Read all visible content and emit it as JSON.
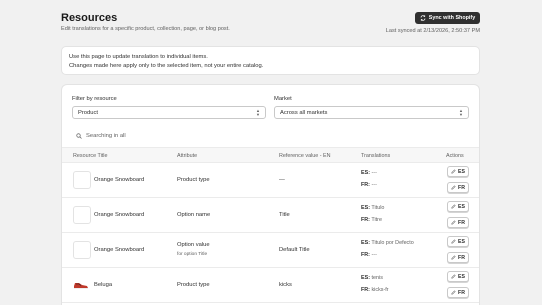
{
  "header": {
    "title": "Resources",
    "subtitle": "Edit translations for a specific product, collection, page, or blog post.",
    "sync_button": "Sync with Shopify",
    "last_synced": "Last synced at 2/13/2026, 2:50:37 PM"
  },
  "info": {
    "line1": "Use this page to update translation to individual items.",
    "line2": "Changes made here apply only to the selected item, not your entire catalog."
  },
  "filters": {
    "resource_label": "Filter by resource",
    "resource_value": "Product",
    "market_label": "Market",
    "market_value": "Across all markets"
  },
  "search": {
    "placeholder": "Searching in all"
  },
  "table": {
    "headers": {
      "title": "Resource Title",
      "attribute": "Attribute",
      "reference": "Reference value - EN",
      "translations": "Translations",
      "actions": "Actions"
    },
    "rows": [
      {
        "title": "Orange Snowboard",
        "attribute": "Product type",
        "attribute_sub": "",
        "reference": "—",
        "es_label": "ES:",
        "es_value": "---",
        "fr_label": "FR:",
        "fr_value": "---",
        "btn_es": "ES",
        "btn_fr": "FR"
      },
      {
        "title": "Orange Snowboard",
        "attribute": "Option name",
        "attribute_sub": "",
        "reference": "Title",
        "es_label": "ES:",
        "es_value": "Titulo",
        "fr_label": "FR:",
        "fr_value": "Titre",
        "btn_es": "ES",
        "btn_fr": "FR"
      },
      {
        "title": "Orange Snowboard",
        "attribute": "Option value",
        "attribute_sub": "for option Title",
        "reference": "Default Title",
        "es_label": "ES:",
        "es_value": "Titulo por Defecto",
        "fr_label": "FR:",
        "fr_value": "---",
        "btn_es": "ES",
        "btn_fr": "FR"
      },
      {
        "title": "Beluga",
        "attribute": "Product type",
        "attribute_sub": "",
        "reference": "kicks",
        "es_label": "ES:",
        "es_value": "tenis",
        "fr_label": "FR:",
        "fr_value": "kicks-fr",
        "btn_es": "ES",
        "btn_fr": "FR"
      }
    ]
  },
  "icons": {
    "sync": "refresh-icon",
    "search": "search-icon",
    "edit": "pencil-icon",
    "select_arrows": "select-arrows-icon",
    "thumbnail_placeholder": "image-placeholder",
    "shoe": "shoe-image"
  }
}
